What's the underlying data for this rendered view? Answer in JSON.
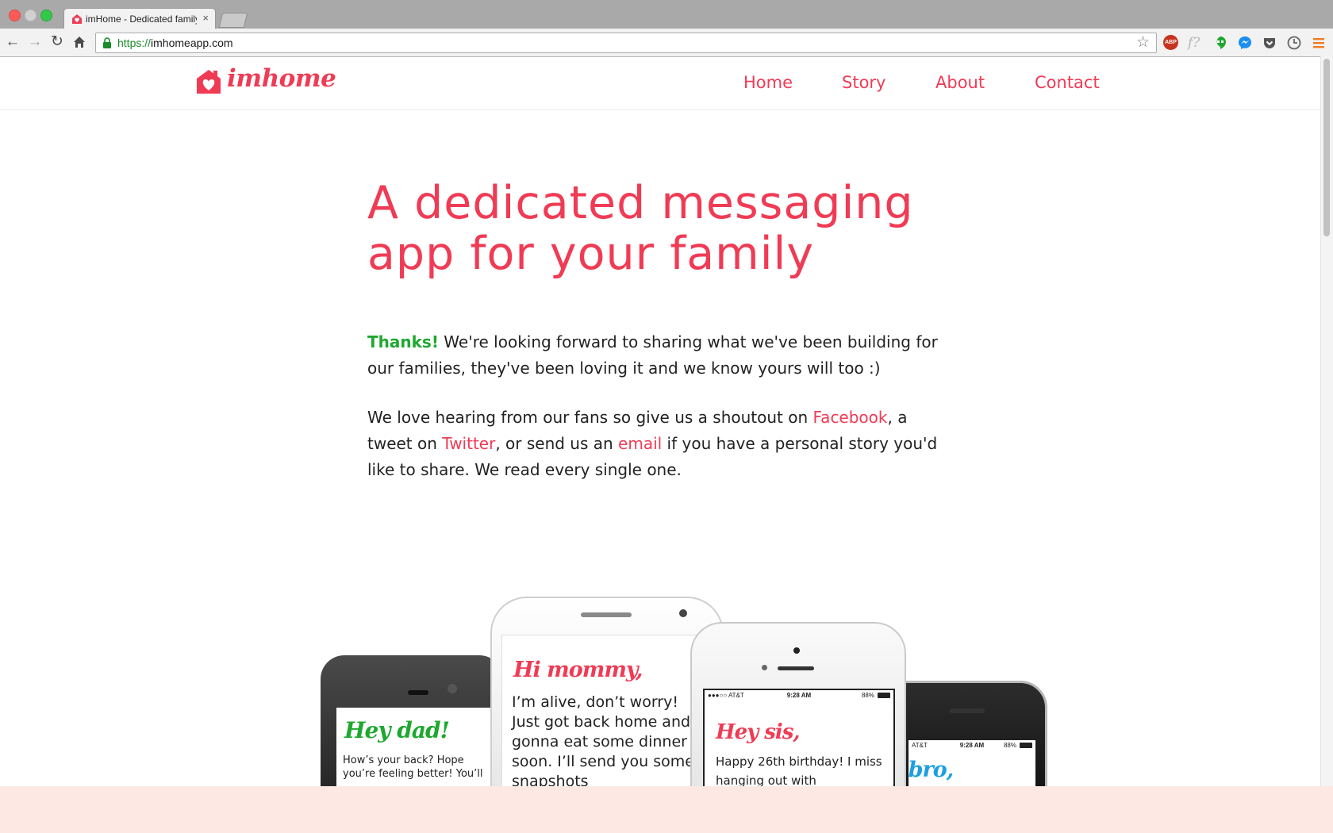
{
  "browser": {
    "tab_title": "imHome - Dedicated family",
    "tab_close": "×",
    "url_scheme": "https://",
    "url_host": "imhomeapp.com",
    "extensions": {
      "abp_label": "ABP",
      "f_label": "f?"
    }
  },
  "header": {
    "logo_text": "imhome",
    "nav": {
      "home": "Home",
      "story": "Story",
      "about": "About",
      "contact": "Contact"
    }
  },
  "hero": {
    "headline": "A dedicated messaging app for your family",
    "p1": {
      "thanks": "Thanks!",
      "text": " We're looking forward to sharing what we've been building for our families, they've been loving it and we know yours will too :)"
    },
    "p2": {
      "t1": "We love hearing from our fans so give us a shoutout on ",
      "facebook": "Facebook",
      "t2": ", a tweet on ",
      "twitter": "Twitter",
      "t3": ", or send us an ",
      "email": "email",
      "t4": " if you have a personal story you'd like to share. We read every single one."
    }
  },
  "phones": {
    "dad": {
      "greeting": "Hey dad!",
      "message": "How’s your back? Hope you’re feeling better! You’ll"
    },
    "mommy": {
      "greeting": "Hi mommy,",
      "message": "I’m alive, don’t worry! Just got back home and gonna eat some dinner soon. I’ll send you some snapshots"
    },
    "sis": {
      "greeting": "Hey sis,",
      "message": "Happy 26th birthday! I miss hanging out with",
      "status_carrier": "●●●○○ AT&T",
      "status_time": "9:28 AM",
      "status_battery": "88%"
    },
    "bro": {
      "greeting": "l bro,",
      "status_carrier": "AT&T",
      "status_time": "9:28 AM",
      "status_battery": "88%"
    }
  },
  "colors": {
    "brand_red": "#f03b55",
    "thanks_green": "#1ea82f",
    "bro_blue": "#1aa0e0",
    "footer_band": "#fde8e3"
  }
}
